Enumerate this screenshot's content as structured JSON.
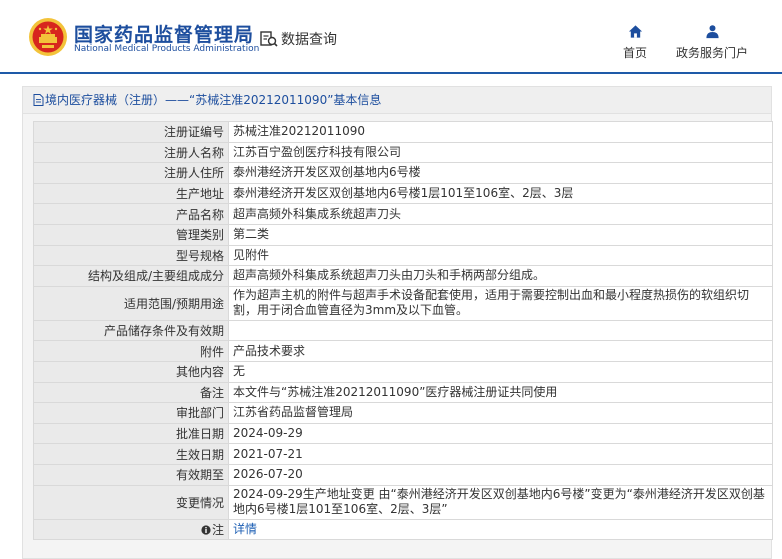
{
  "header": {
    "brand_cn": "国家药品监督管理局",
    "brand_en": "National Medical Products Administration",
    "query_label": "数据查询",
    "nav": {
      "home": "首页",
      "gov": "政务服务门户"
    }
  },
  "panel": {
    "title": "境内医疗器械（注册）——“苏械注准20212011090”基本信息"
  },
  "rows": [
    {
      "label": "注册证编号",
      "value": "苏械注准20212011090"
    },
    {
      "label": "注册人名称",
      "value": "江苏百宁盈创医疗科技有限公司"
    },
    {
      "label": "注册人住所",
      "value": "泰州港经济开发区双创基地内6号楼"
    },
    {
      "label": "生产地址",
      "value": "泰州港经济开发区双创基地内6号楼1层101至106室、2层、3层"
    },
    {
      "label": "产品名称",
      "value": "超声高频外科集成系统超声刀头"
    },
    {
      "label": "管理类别",
      "value": "第二类"
    },
    {
      "label": "型号规格",
      "value": "见附件"
    },
    {
      "label": "结构及组成/主要组成成分",
      "value": "超声高频外科集成系统超声刀头由刀头和手柄两部分组成。"
    },
    {
      "label": "适用范围/预期用途",
      "value": "作为超声主机的附件与超声手术设备配套使用，适用于需要控制出血和最小程度热损伤的软组织切割，用于闭合血管直径为3mm及以下血管。"
    },
    {
      "label": "产品储存条件及有效期",
      "value": ""
    },
    {
      "label": "附件",
      "value": "产品技术要求"
    },
    {
      "label": "其他内容",
      "value": "无"
    },
    {
      "label": "备注",
      "value": "本文件与“苏械注准20212011090”医疗器械注册证共同使用"
    },
    {
      "label": "审批部门",
      "value": "江苏省药品监督管理局"
    },
    {
      "label": "批准日期",
      "value": "2024-09-29"
    },
    {
      "label": "生效日期",
      "value": "2021-07-21"
    },
    {
      "label": "有效期至",
      "value": "2026-07-20"
    },
    {
      "label": "变更情况",
      "value": "2024-09-29生产地址变更 由“泰州港经济开发区双创基地内6号楼”变更为“泰州港经济开发区双创基地内6号楼1层101至106室、2层、3层”"
    },
    {
      "label": "注",
      "value": "详情"
    }
  ],
  "colors": {
    "brand_blue": "#1d4e9e",
    "link_blue": "#1d5fb4",
    "emblem_red": "#d7261e",
    "emblem_gold": "#f3c33a"
  }
}
